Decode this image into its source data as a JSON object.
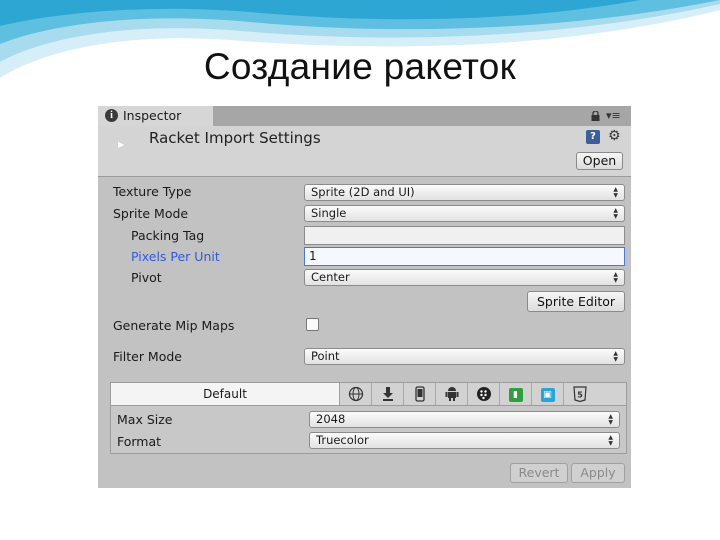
{
  "slide": {
    "title": "Создание ракеток"
  },
  "inspector": {
    "tab_label": "Inspector",
    "tab_icon": "info-icon",
    "header_title": "Racket Import Settings",
    "open_button": "Open",
    "fields": {
      "texture_type": {
        "label": "Texture Type",
        "value": "Sprite (2D and UI)"
      },
      "sprite_mode": {
        "label": "Sprite Mode",
        "value": "Single"
      },
      "packing_tag": {
        "label": "Packing Tag",
        "value": ""
      },
      "pixels_per_unit": {
        "label": "Pixels Per Unit",
        "value": "1"
      },
      "pivot": {
        "label": "Pivot",
        "value": "Center"
      },
      "sprite_editor": "Sprite Editor",
      "generate_mip_maps": {
        "label": "Generate Mip Maps",
        "checked": false
      },
      "filter_mode": {
        "label": "Filter Mode",
        "value": "Point"
      }
    },
    "platforms": {
      "default_label": "Default",
      "icons": [
        "globe-icon",
        "download-icon",
        "ios-icon",
        "android-icon",
        "blackberry-icon",
        "windows-store-icon",
        "windows-phone-icon",
        "html5-icon"
      ],
      "max_size": {
        "label": "Max Size",
        "value": "2048"
      },
      "format": {
        "label": "Format",
        "value": "Truecolor"
      }
    },
    "revert_button": "Revert",
    "apply_button": "Apply"
  }
}
